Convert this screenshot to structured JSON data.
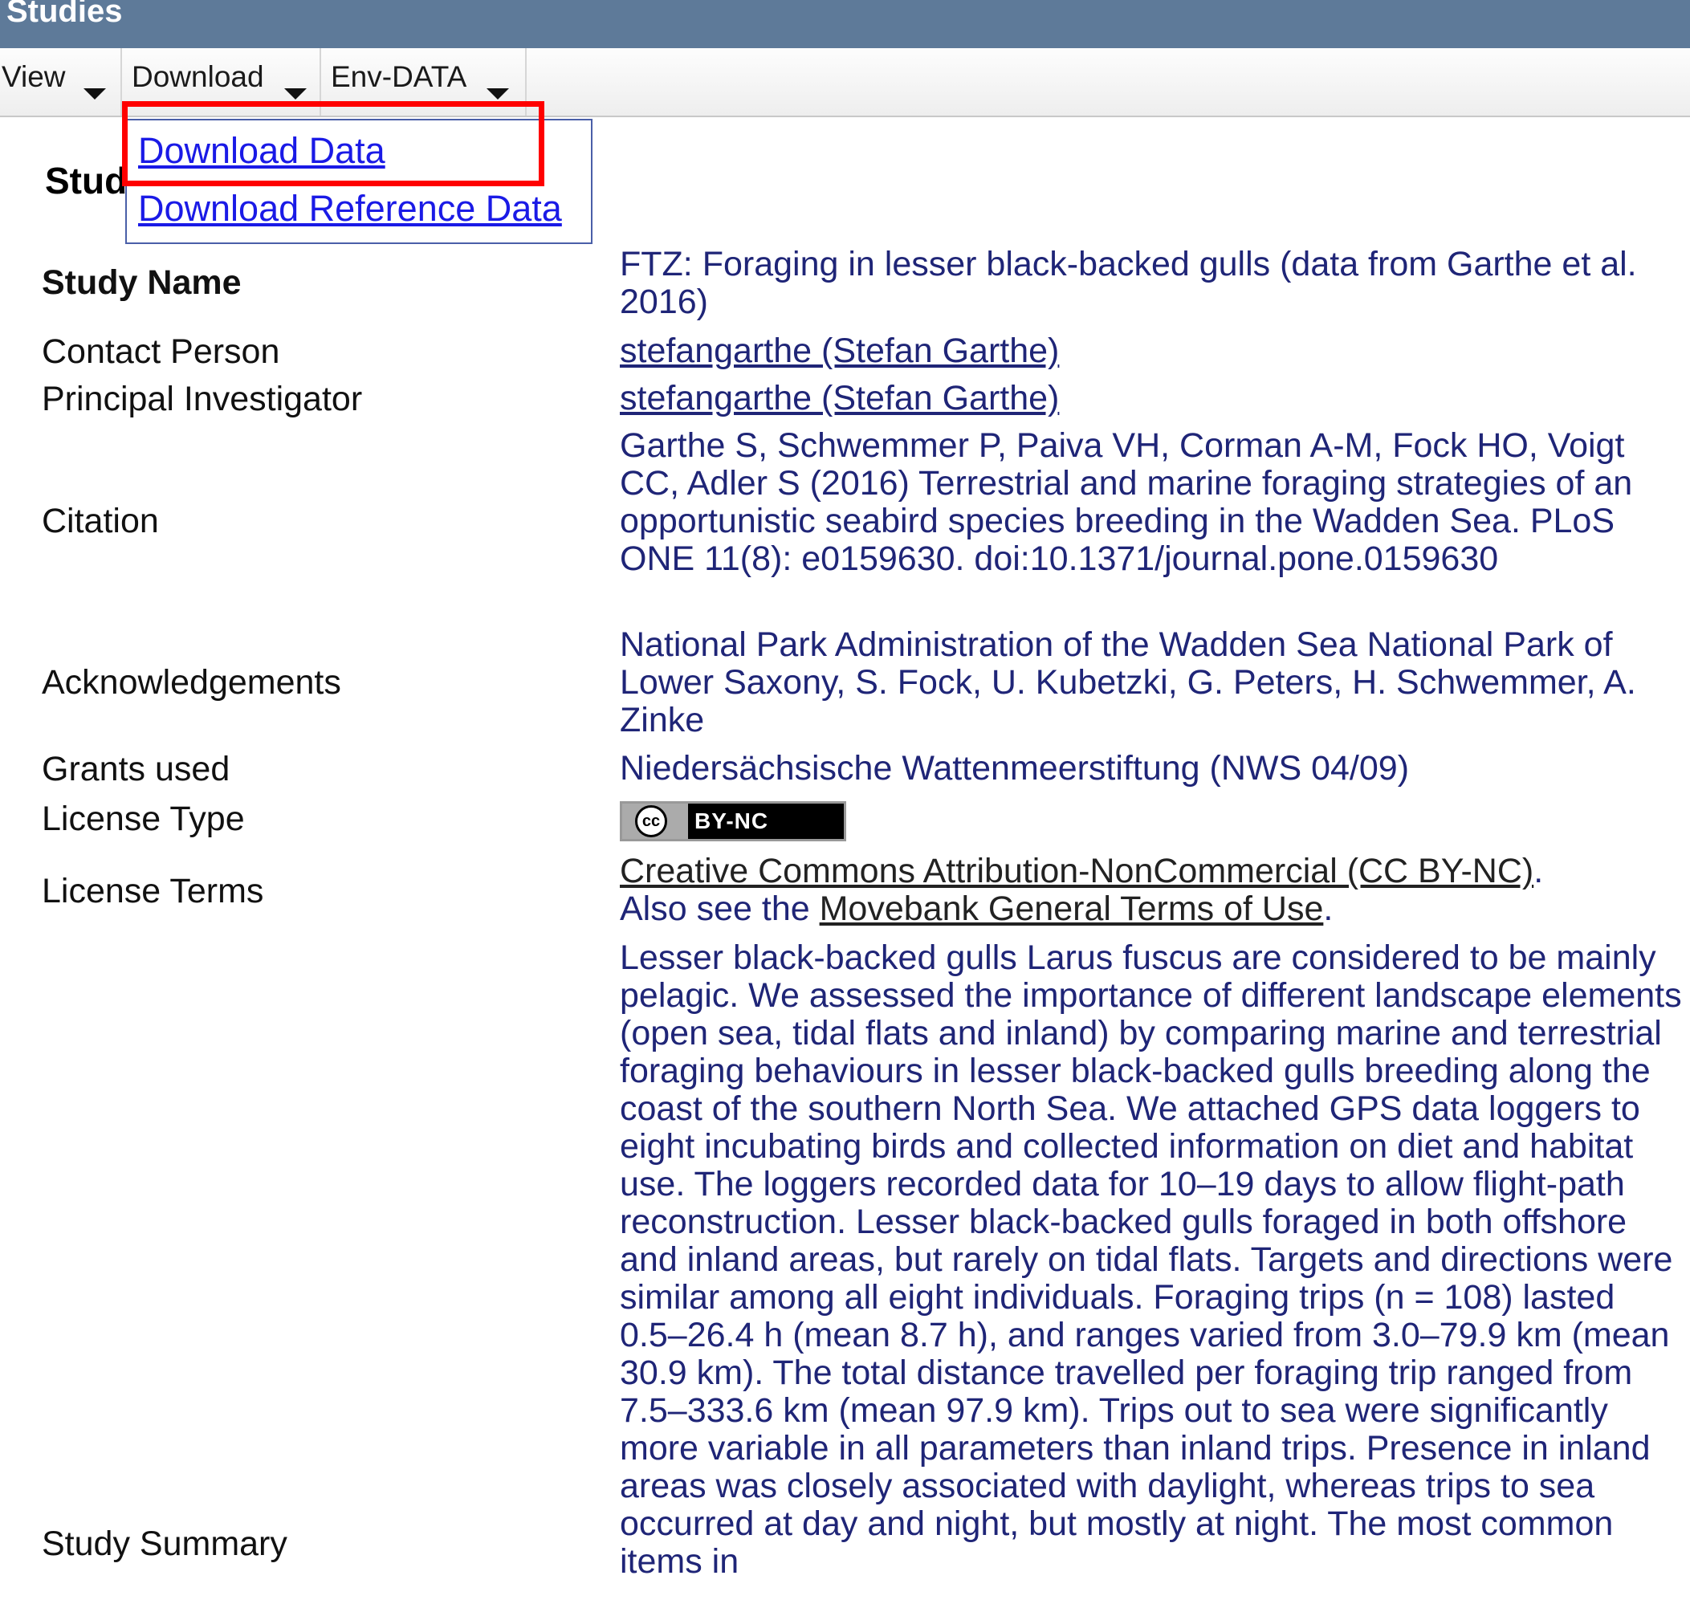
{
  "window": {
    "title": "Studies"
  },
  "menu": {
    "items": [
      {
        "label": "View"
      },
      {
        "label": "Download"
      },
      {
        "label": "Env-DATA"
      }
    ]
  },
  "dropdown": {
    "items": [
      {
        "label": "Download Data"
      },
      {
        "label": "Download Reference Data"
      }
    ],
    "highlighted_item": "Download Data",
    "highlight_color": "#ff0000"
  },
  "section": {
    "title": "Study"
  },
  "study": {
    "name": {
      "label": "Study Name",
      "value": "FTZ: Foraging in lesser black-backed gulls (data from Garthe et al. 2016)"
    },
    "contact_person": {
      "label": "Contact Person",
      "value": "stefangarthe (Stefan Garthe)"
    },
    "principal_investigator": {
      "label": "Principal Investigator",
      "value": "stefangarthe (Stefan Garthe)"
    },
    "citation": {
      "label": "Citation",
      "value": "Garthe S, Schwemmer P, Paiva VH, Corman A-M, Fock HO, Voigt CC, Adler S (2016) Terrestrial and marine foraging strategies of an opportunistic seabird species breeding in the Wadden Sea. PLoS ONE 11(8): e0159630. doi:10.1371/journal.pone.0159630"
    },
    "acknowledgements": {
      "label": "Acknowledgements",
      "value": "National Park Administration of the Wadden Sea National Park of Lower Saxony, S. Fock, U. Kubetzki, G. Peters, H. Schwemmer, A. Zinke"
    },
    "grants": {
      "label": "Grants used",
      "value": "Niedersächsische Wattenmeerstiftung (NWS 04/09)"
    },
    "license_type": {
      "label": "License Type",
      "badge_text": "BY-NC",
      "badge_icon": "cc-icon"
    },
    "license_terms": {
      "label": "License Terms",
      "link1": "Creative Commons Attribution-NonCommercial (CC BY-NC)",
      "sep": ".",
      "also": "Also see the ",
      "link2": "Movebank General Terms of Use",
      "end": "."
    },
    "summary": {
      "label": "Study Summary",
      "value": "Lesser black-backed gulls Larus fuscus are considered to be mainly pelagic. We assessed the importance of different landscape elements (open sea, tidal flats and inland) by comparing marine and terrestrial foraging behaviours in lesser black-backed gulls breeding along the coast of the southern North Sea. We attached GPS data loggers to eight incubating birds and collected information on diet and habitat use. The loggers recorded data for 10–19 days to allow flight-path reconstruction. Lesser black-backed gulls foraged in both offshore and inland areas, but rarely on tidal flats. Targets and directions were similar among all eight individuals. Foraging trips (n = 108) lasted 0.5–26.4 h (mean 8.7 h), and ranges varied from 3.0–79.9 km (mean 30.9 km). The total distance travelled per foraging trip ranged from 7.5–333.6 km (mean 97.9 km). Trips out to sea were significantly more variable in all parameters than inland trips. Presence in inland areas was closely associated with daylight, whereas trips to sea occurred at day and night, but mostly at night. The most common items in"
    }
  }
}
